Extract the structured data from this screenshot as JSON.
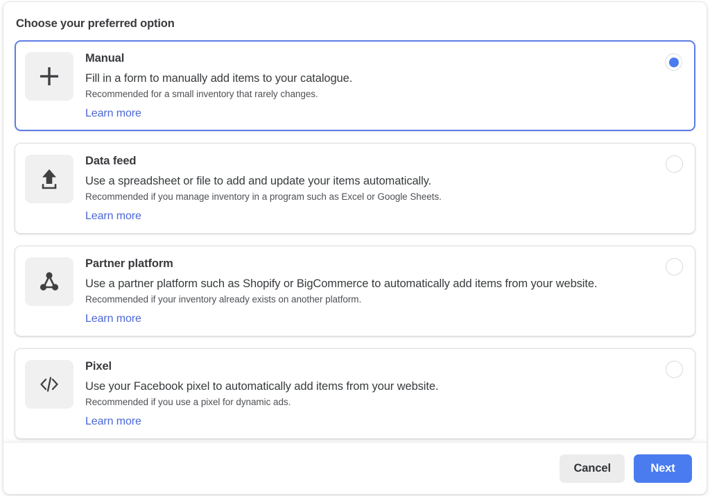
{
  "dialog": {
    "title": "Choose your preferred option",
    "options": [
      {
        "id": "manual",
        "icon": "plus-icon",
        "title": "Manual",
        "description": "Fill in a form to manually add items to your catalogue.",
        "recommendation": "Recommended for a small inventory that rarely changes.",
        "learn_more": "Learn more",
        "selected": true
      },
      {
        "id": "data-feed",
        "icon": "upload-icon",
        "title": "Data feed",
        "description": "Use a spreadsheet or file to add and update your items automatically.",
        "recommendation": "Recommended if you manage inventory in a program such as Excel or Google Sheets.",
        "learn_more": "Learn more",
        "selected": false
      },
      {
        "id": "partner-platform",
        "icon": "network-nodes-icon",
        "title": "Partner platform",
        "description": "Use a partner platform such as Shopify or BigCommerce to automatically add items from your website.",
        "recommendation": "Recommended if your inventory already exists on another platform.",
        "learn_more": "Learn more",
        "selected": false
      },
      {
        "id": "pixel",
        "icon": "code-icon",
        "title": "Pixel",
        "description": "Use your Facebook pixel to automatically add items from your website.",
        "recommendation": "Recommended if you use a pixel for dynamic ads.",
        "learn_more": "Learn more",
        "selected": false
      }
    ],
    "footer": {
      "cancel_label": "Cancel",
      "next_label": "Next"
    }
  },
  "colors": {
    "accent": "#4a7cf0",
    "selected_border": "#5e7ce6",
    "link": "#4a66d6",
    "icon_tile_bg": "#f0f0f1",
    "cancel_bg": "#ececed",
    "text_primary": "#383a3d",
    "text_secondary": "#4e5054"
  }
}
